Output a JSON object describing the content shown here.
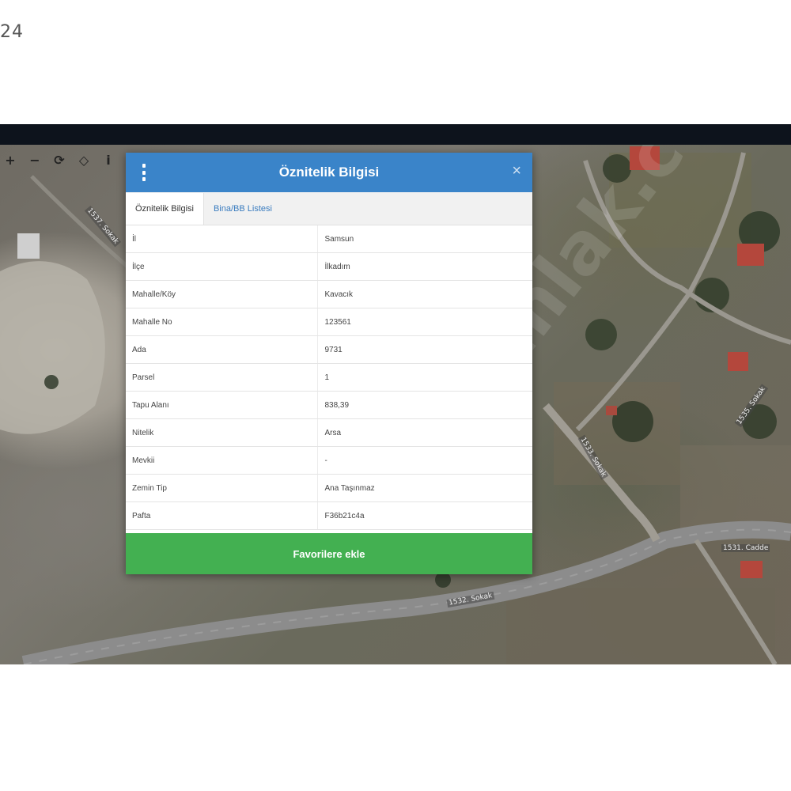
{
  "page": {
    "corner_text": "24"
  },
  "map": {
    "watermark": "Emlak.com",
    "road_labels": [
      "1537. Sokak",
      "1535. Sokak",
      "1532. Sokak",
      "1531. Cadde",
      "1533. Sokak"
    ]
  },
  "map_tools": [
    {
      "name": "zoom-in-icon",
      "glyph": "+"
    },
    {
      "name": "zoom-out-icon",
      "glyph": "−"
    },
    {
      "name": "refresh-icon",
      "glyph": "⟳"
    },
    {
      "name": "locate-icon",
      "glyph": "◇"
    },
    {
      "name": "info-icon",
      "glyph": "i"
    }
  ],
  "dialog": {
    "title": "Öznitelik Bilgisi",
    "close_glyph": "×",
    "tabs": [
      {
        "label": "Öznitelik Bilgisi",
        "active": true
      },
      {
        "label": "Bina/BB Listesi",
        "active": false
      }
    ],
    "rows": [
      {
        "key": "İl",
        "value": "Samsun"
      },
      {
        "key": "İlçe",
        "value": "İlkadım"
      },
      {
        "key": "Mahalle/Köy",
        "value": "Kavacık"
      },
      {
        "key": "Mahalle No",
        "value": "123561"
      },
      {
        "key": "Ada",
        "value": "9731"
      },
      {
        "key": "Parsel",
        "value": "1"
      },
      {
        "key": "Tapu Alanı",
        "value": "838,39"
      },
      {
        "key": "Nitelik",
        "value": "Arsa"
      },
      {
        "key": "Mevkii",
        "value": "-"
      },
      {
        "key": "Zemin Tip",
        "value": "Ana Taşınmaz"
      },
      {
        "key": "Pafta",
        "value": "F36b21c4a"
      }
    ],
    "favorite_button": "Favorilere ekle"
  },
  "colors": {
    "header": "#3a84c9",
    "favorite": "#43b051",
    "tab_link": "#3a7cbf"
  }
}
